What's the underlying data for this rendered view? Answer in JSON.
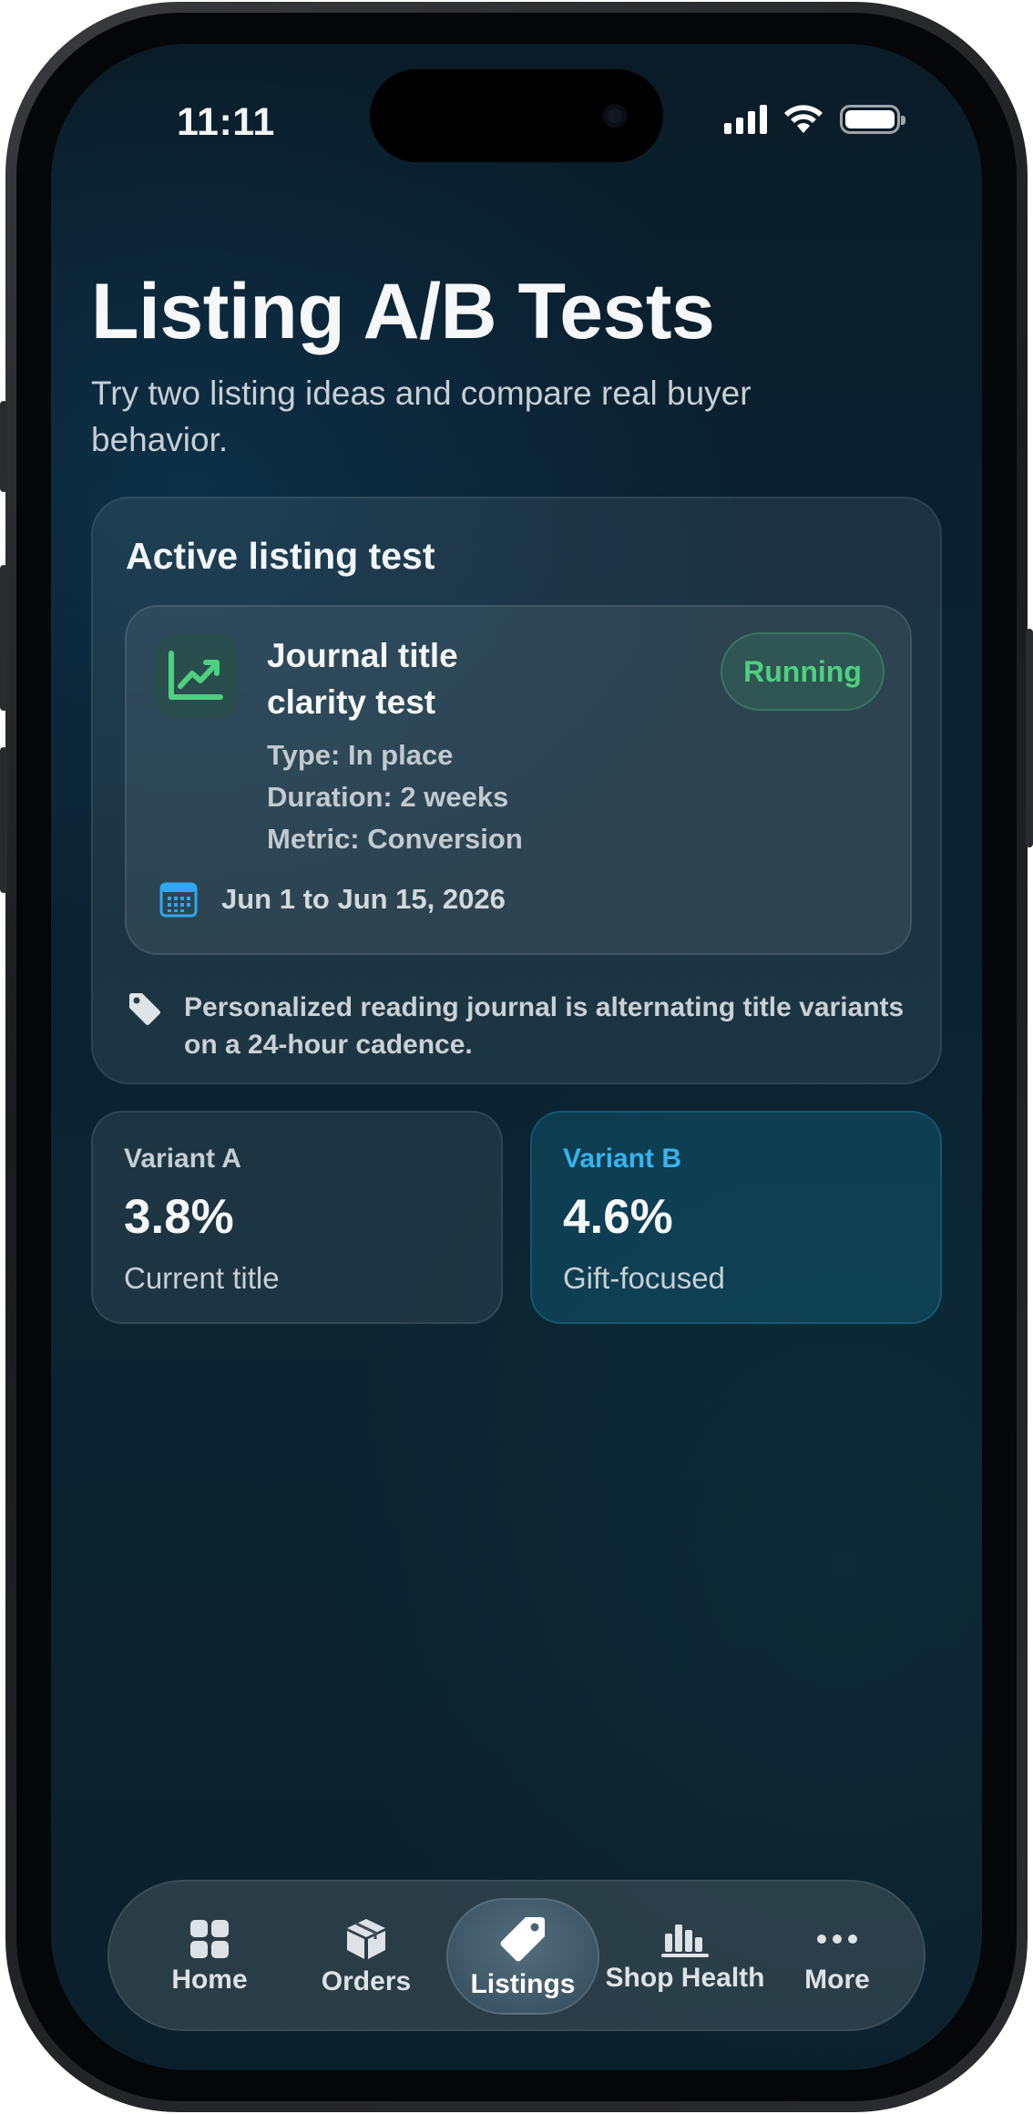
{
  "status_bar": {
    "time": "11:11"
  },
  "header": {
    "title": "Listing A/B Tests",
    "subtitle": "Try two listing ideas and compare real buyer behavior."
  },
  "active_test": {
    "heading": "Active listing test",
    "title": "Journal title clarity test",
    "status": "Running",
    "type": "Type: In place",
    "duration": "Duration: 2 weeks",
    "metric": "Metric: Conversion",
    "date_range": "Jun 1 to Jun 15, 2026",
    "note": "Personalized reading journal is alternating title variants on a 24-hour cadence."
  },
  "variants": [
    {
      "label": "Variant A",
      "value": "3.8%",
      "description": "Current title"
    },
    {
      "label": "Variant B",
      "value": "4.6%",
      "description": "Gift-focused"
    }
  ],
  "tabbar": {
    "items": [
      {
        "label": "Home",
        "icon": "grid-icon"
      },
      {
        "label": "Orders",
        "icon": "box-icon"
      },
      {
        "label": "Listings",
        "icon": "tag-icon",
        "active": true
      },
      {
        "label": "Shop Health",
        "icon": "bar-chart-icon"
      },
      {
        "label": "More",
        "icon": "ellipsis-icon"
      }
    ]
  },
  "colors": {
    "running_green": "#4ed07f",
    "variant_b_blue": "#37b4ef",
    "calendar_blue": "#2ea8f0"
  }
}
